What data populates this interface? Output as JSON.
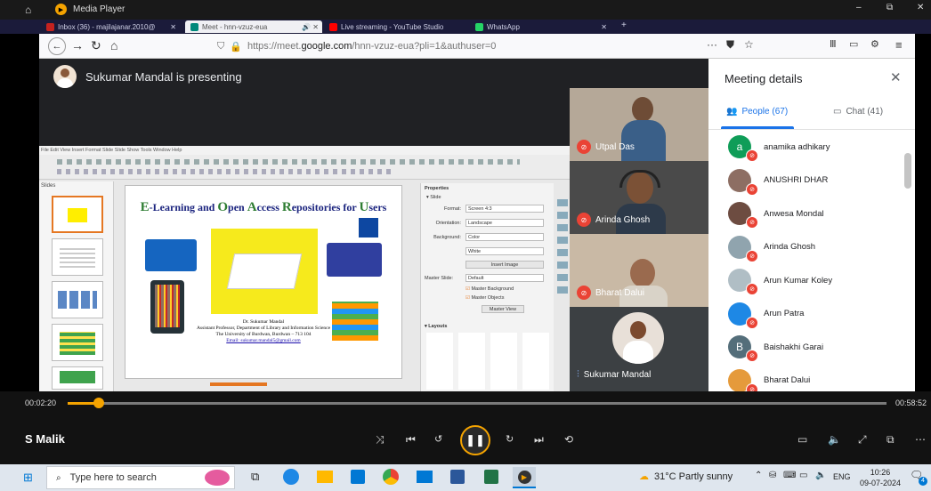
{
  "player": {
    "title": "Media Player",
    "minimize": "–",
    "maximize": "⧉",
    "close": "✕"
  },
  "browser": {
    "tabs": [
      {
        "label": "Inbox (36) - majilajanar.2010@",
        "color": "#c5221f"
      },
      {
        "label": "Meet - hnn-vzuz-eua",
        "color": "#00897b"
      },
      {
        "label": "Live streaming - YouTube Studio",
        "color": "#ff0000"
      },
      {
        "label": "WhatsApp",
        "color": "#25d366"
      }
    ],
    "url_prefix": "https://meet.",
    "url_domain": "google.com",
    "url_suffix": "/hnn-vzuz-eua?pli=1&authuser=0"
  },
  "meet": {
    "presenting": "Sukumar Mandal is presenting",
    "participants": [
      {
        "name": "Utpal Das",
        "muted": true
      },
      {
        "name": "Arinda Ghosh",
        "muted": true
      },
      {
        "name": "Bharat Dalui",
        "muted": true
      },
      {
        "name": "Sukumar Mandal",
        "muted": false
      }
    ]
  },
  "sidebar": {
    "title": "Meeting details",
    "people_tab": "People (67)",
    "chat_tab": "Chat (41)",
    "people": [
      {
        "name": "anamika adhikary",
        "initial": "a",
        "color": "#0f9d58"
      },
      {
        "name": "ANUSHRI DHAR",
        "initial": "",
        "color": "#8d6e63"
      },
      {
        "name": "Anwesa Mondal",
        "initial": "",
        "color": "#6d4c41"
      },
      {
        "name": "Arinda Ghosh",
        "initial": "",
        "color": "#90a4ae"
      },
      {
        "name": "Arun Kumar Koley",
        "initial": "",
        "color": "#b0bec5"
      },
      {
        "name": "Arun Patra",
        "initial": "",
        "color": "#1e88e5"
      },
      {
        "name": "Baishakhi Garai",
        "initial": "B",
        "color": "#546e7a"
      },
      {
        "name": "Bharat Dalui",
        "initial": "",
        "color": "#e59a3b"
      },
      {
        "name": "Bidisha Pal",
        "initial": "",
        "color": "#78909c"
      },
      {
        "name": "Birbanu mondal",
        "initial": "B",
        "color": "#5c6bc0"
      }
    ]
  },
  "slide": {
    "menu": "File  Edit  View  Insert  Format  Slide  Slide Show  Tools  Window  Help",
    "slides_label": "Slides",
    "title_parts": [
      "E",
      "-Learning and ",
      "O",
      "pen ",
      "A",
      "ccess ",
      "R",
      "epositories for ",
      "U",
      "sers"
    ],
    "author": "Dr. Sukumar Mandal",
    "affil1": "Assistant Professor, Department of Library and Information Science",
    "affil2": "The University of Burdwan, Burdwan – 713 104",
    "email": "Email: sukumar.mandal5@gmail.com",
    "properties": {
      "title": "Properties",
      "section": "Slide",
      "rows": [
        {
          "label": "Format:",
          "value": "Screen 4:3"
        },
        {
          "label": "Orientation:",
          "value": "Landscape"
        },
        {
          "label": "Background:",
          "value": "Color"
        },
        {
          "label": "",
          "value": "White"
        }
      ],
      "insert_image": "Insert Image",
      "master_label": "Master Slide:",
      "master_value": "Default",
      "master_bg": "Master Background",
      "master_obj": "Master Objects",
      "master_view": "Master View",
      "layouts": "Layouts"
    }
  },
  "controls": {
    "elapsed": "00:02:20",
    "total": "00:58:52",
    "progress": 0.038,
    "owner": "S Malik"
  },
  "taskbar": {
    "search": "Type here to search",
    "weather": "31°C  Partly sunny",
    "lang": "ENG",
    "time": "10:26",
    "date": "09-07-2024",
    "notif": "4"
  }
}
